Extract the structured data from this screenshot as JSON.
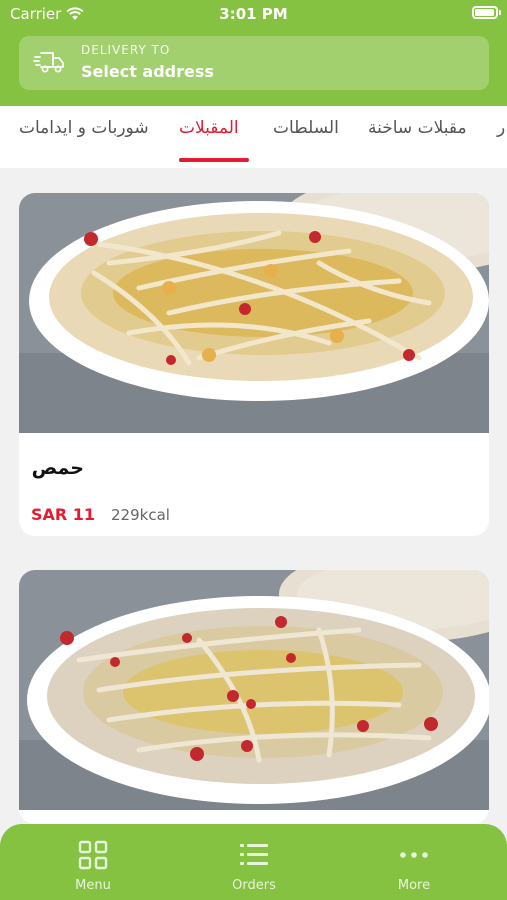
{
  "status_bar": {
    "carrier": "Carrier",
    "time": "3:01 PM"
  },
  "delivery": {
    "label": "DELIVERY TO",
    "value": "Select address"
  },
  "tabs": [
    {
      "label": "ر"
    },
    {
      "label": "مقبلات ساخنة"
    },
    {
      "label": "السلطات"
    },
    {
      "label": "المقبلات",
      "active": true
    },
    {
      "label": "شوربات و ايدامات"
    }
  ],
  "items": [
    {
      "name": "حمص",
      "price": "SAR 11",
      "kcal": "229kcal"
    },
    {
      "name": ""
    }
  ],
  "nav": [
    {
      "label": "Menu",
      "icon": "grid-icon"
    },
    {
      "label": "Orders",
      "icon": "list-icon"
    },
    {
      "label": "More",
      "icon": "more-dots-icon"
    }
  ],
  "colors": {
    "brand_green": "#85c241",
    "accent_red": "#e21d2f"
  }
}
